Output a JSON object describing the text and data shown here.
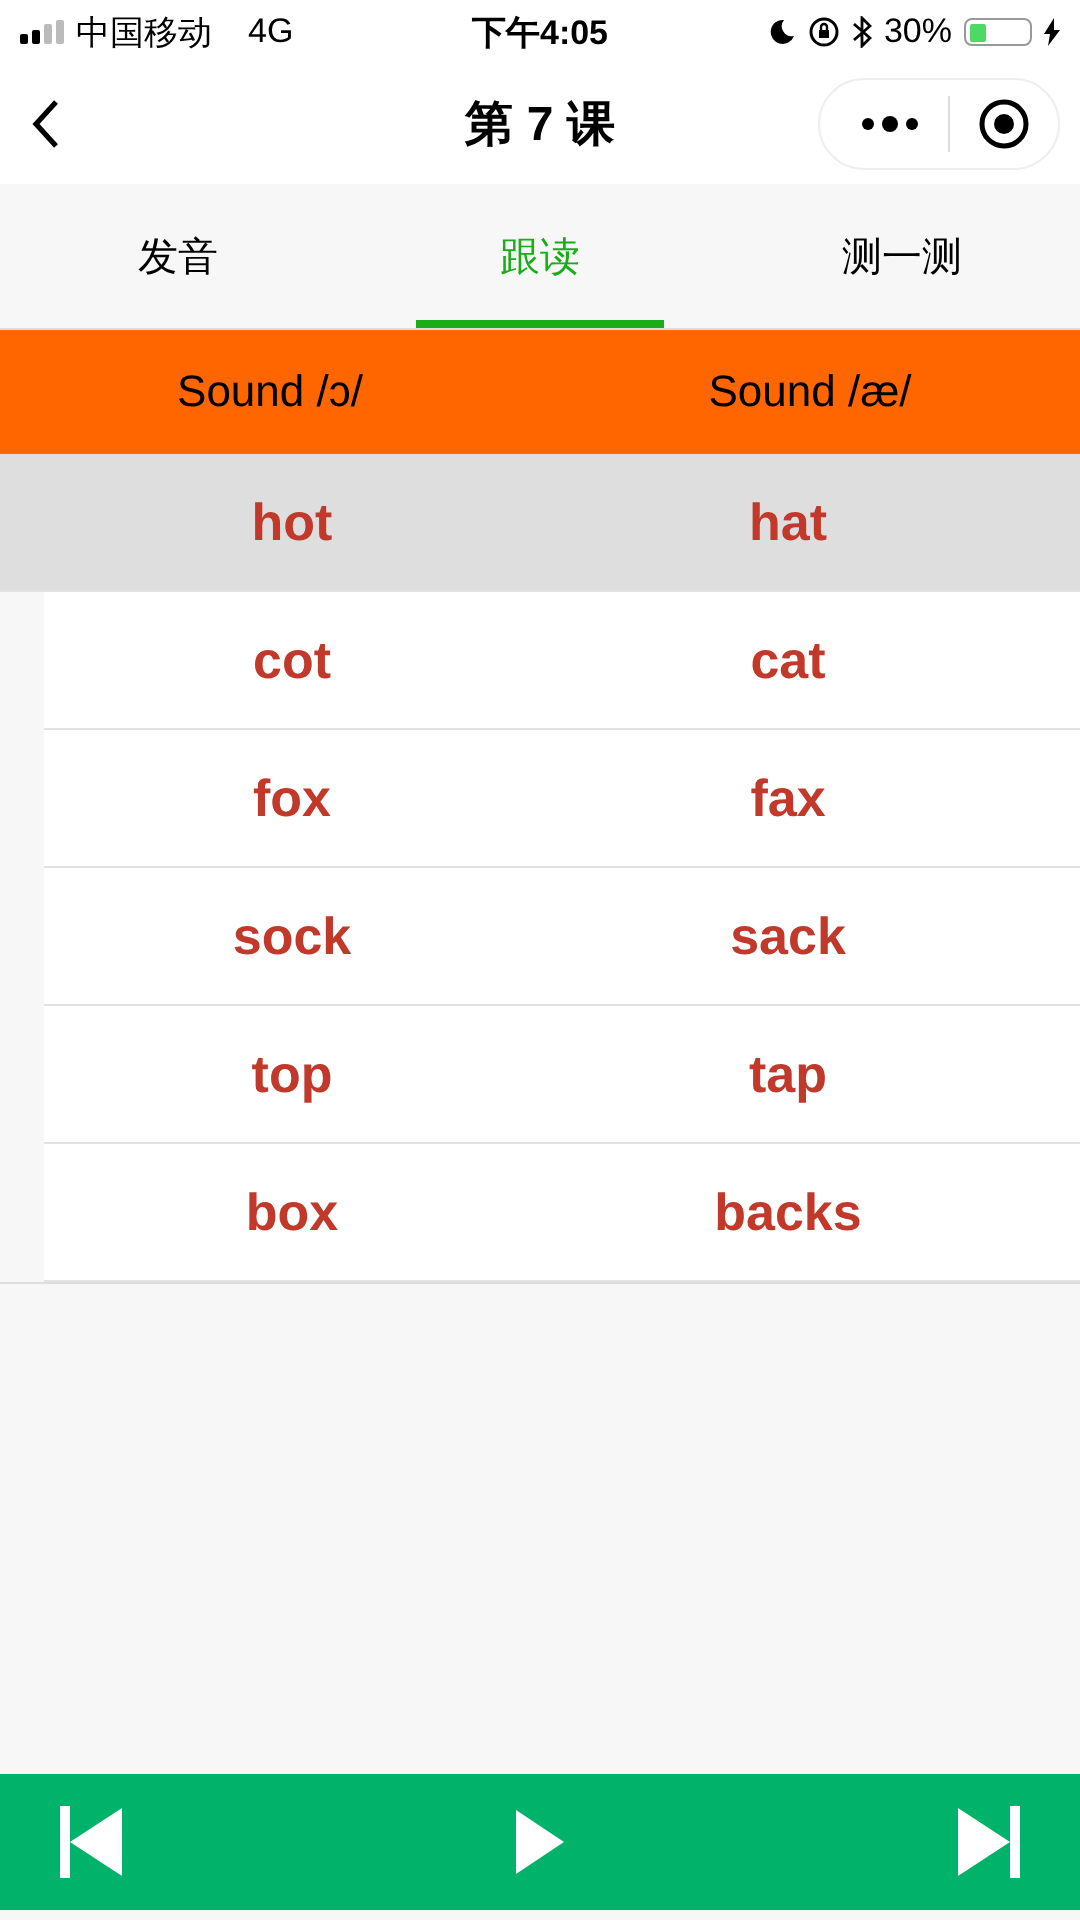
{
  "status_bar": {
    "carrier": "中国移动",
    "network": "4G",
    "time": "下午4:05",
    "battery": "30%"
  },
  "nav": {
    "title": "第 7 课"
  },
  "tabs": [
    {
      "label": "发音",
      "selected": false
    },
    {
      "label": "跟读",
      "selected": true
    },
    {
      "label": "测一测",
      "selected": false
    }
  ],
  "table": {
    "columns": [
      "Sound /ɔ/",
      "Sound /æ/"
    ],
    "rows": [
      {
        "cells": [
          "hot",
          "hat"
        ],
        "selected": true
      },
      {
        "cells": [
          "cot",
          "cat"
        ],
        "selected": false
      },
      {
        "cells": [
          "fox",
          "fax"
        ],
        "selected": false
      },
      {
        "cells": [
          "sock",
          "sack"
        ],
        "selected": false
      },
      {
        "cells": [
          "top",
          "tap"
        ],
        "selected": false
      },
      {
        "cells": [
          "box",
          "backs"
        ],
        "selected": false
      }
    ]
  }
}
